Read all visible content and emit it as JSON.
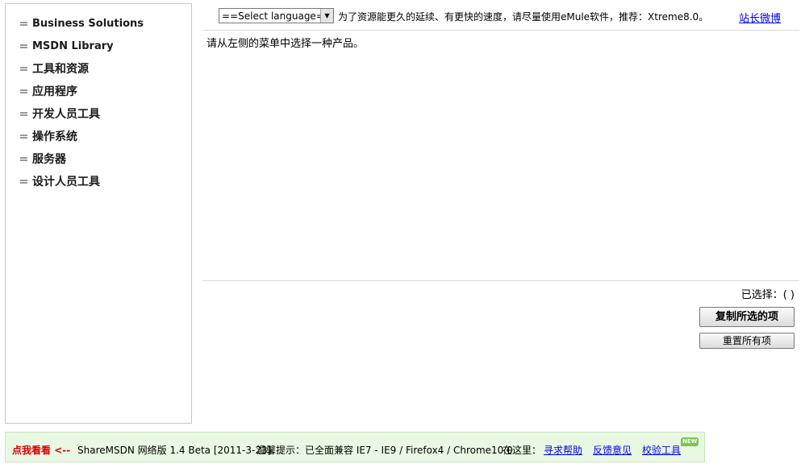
{
  "sidebar": {
    "items": [
      {
        "label": "Business Solutions"
      },
      {
        "label": "MSDN Library"
      },
      {
        "label": "工具和资源"
      },
      {
        "label": "应用程序"
      },
      {
        "label": "开发人员工具"
      },
      {
        "label": "操作系统"
      },
      {
        "label": "服务器"
      },
      {
        "label": "设计人员工具"
      }
    ]
  },
  "toolbar": {
    "language_select": "==Select language==",
    "notice": "为了资源能更久的延续、有更快的速度，请尽量使用eMule软件，推荐：Xtreme8.0。",
    "weibo_link": "站长微博"
  },
  "main": {
    "prompt": "请从左侧的菜单中选择一种产品。",
    "selected_count": "已选择：( )",
    "copy_button": "复制所选的项",
    "reset_button": "重置所有项"
  },
  "footer": {
    "click_me": "点我看看 <--",
    "product_info": "ShareMSDN 网络版 1.4 Beta [2011-3-23]",
    "tip": "温馨提示：已全面兼容 IE7 - IE9 / Firefox4 / Chrome10.0",
    "here_label": "在这里：",
    "help_link": "寻求帮助",
    "feedback_link": "反馈意见",
    "check_link": "校验工具",
    "new_badge": "NEW"
  },
  "colors": {
    "link": "#0000ee",
    "footer_bg": "#e9f8e3",
    "click_me": "#dd0000",
    "new_badge": "#78c850"
  }
}
